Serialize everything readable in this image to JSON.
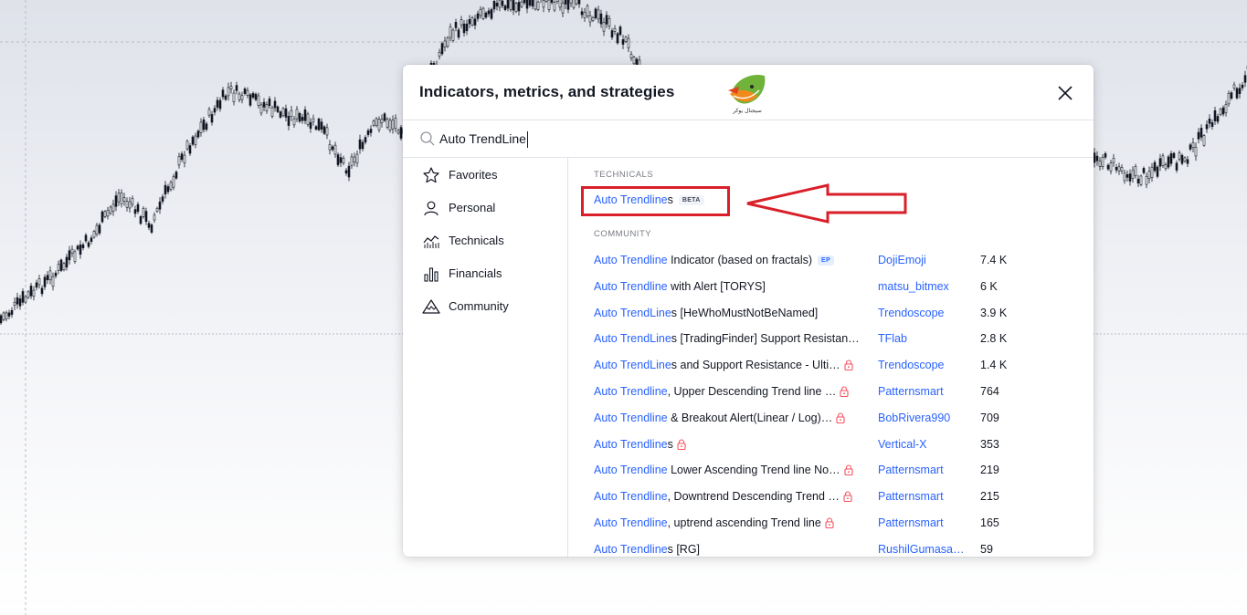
{
  "dialog": {
    "title": "Indicators, metrics, and strategies",
    "logo_text": "سیجنال یوکر"
  },
  "search": {
    "value": "Auto TrendLine",
    "placeholder": "Search"
  },
  "sidebar": {
    "items": [
      {
        "label": "Favorites",
        "icon": "star-icon"
      },
      {
        "label": "Personal",
        "icon": "user-icon"
      },
      {
        "label": "Technicals",
        "icon": "technicals-chart-icon"
      },
      {
        "label": "Financials",
        "icon": "bar-chart-icon"
      },
      {
        "label": "Community",
        "icon": "mountain-icon"
      }
    ]
  },
  "results": {
    "technicals_header": "TECHNICALS",
    "technicals": [
      {
        "match": "Auto Trendline",
        "rest": "s",
        "badge": "BETA"
      }
    ],
    "community_header": "COMMUNITY",
    "community": [
      {
        "match": "Auto Trendline",
        "rest": " Indicator (based on fractals)",
        "badge": "EP",
        "locked": false,
        "author": "DojiEmoji",
        "count": "7.4 K"
      },
      {
        "match": "Auto Trendline",
        "rest": " with Alert [TORYS]",
        "locked": false,
        "author": "matsu_bitmex",
        "count": "6 K"
      },
      {
        "match": "Auto TrendLine",
        "rest": "s [HeWhoMustNotBeNamed]",
        "locked": false,
        "author": "Trendoscope",
        "count": "3.9 K"
      },
      {
        "match": "Auto TrendLine",
        "rest": "s [TradingFinder] Support Resistan…",
        "locked": false,
        "author": "TFlab",
        "count": "2.8 K"
      },
      {
        "match": "Auto TrendLine",
        "rest": "s and Support Resistance - Ulti…",
        "locked": true,
        "author": "Trendoscope",
        "count": "1.4 K"
      },
      {
        "match": "Auto Trendline",
        "rest": ", Upper Descending Trend line …",
        "locked": true,
        "author": "Patternsmart",
        "count": "764"
      },
      {
        "match": "Auto Trendline",
        "rest": " & Breakout Alert(Linear / Log)…",
        "locked": true,
        "author": "BobRivera990",
        "count": "709"
      },
      {
        "match": "Auto Trendline",
        "rest": "s",
        "locked": true,
        "author": "Vertical-X",
        "count": "353"
      },
      {
        "match": "Auto Trendline",
        "rest": " Lower Ascending Trend line No…",
        "locked": true,
        "author": "Patternsmart",
        "count": "219"
      },
      {
        "match": "Auto Trendline",
        "rest": ", Downtrend Descending Trend …",
        "locked": true,
        "author": "Patternsmart",
        "count": "215"
      },
      {
        "match": "Auto Trendline",
        "rest": ", uptrend ascending Trend line",
        "locked": true,
        "author": "Patternsmart",
        "count": "165"
      },
      {
        "match": "Auto Trendline",
        "rest": "s [RG]",
        "locked": false,
        "author": "RushilGumasa…",
        "count": "59"
      }
    ]
  },
  "colors": {
    "accent": "#2962ff",
    "highlight_box": "#d9202a",
    "lock": "#f7525f"
  }
}
